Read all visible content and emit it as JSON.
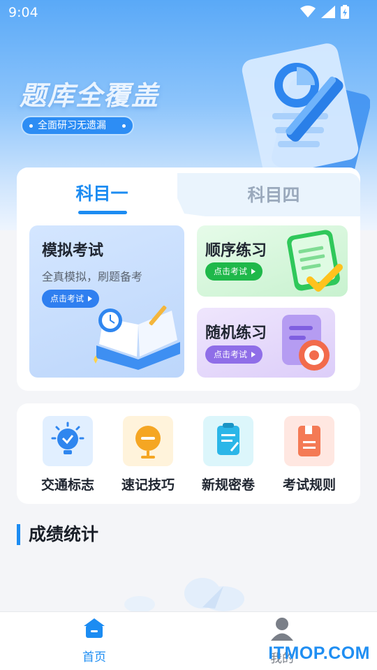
{
  "status_bar": {
    "time": "9:04"
  },
  "hero": {
    "title": "题库全覆盖",
    "pill": "全面研习无遗漏"
  },
  "subject_tabs": [
    {
      "label": "科目一",
      "active": true
    },
    {
      "label": "科目四",
      "active": false
    }
  ],
  "practice_tiles": [
    {
      "title": "模拟考试",
      "subtitle": "全真模拟，刷题备考",
      "button": "点击考试",
      "color": "#2f7ff0"
    },
    {
      "title": "顺序练习",
      "button": "点击考试",
      "color": "#1fb84a"
    },
    {
      "title": "随机练习",
      "button": "点击考试",
      "color": "#8f6ee8"
    }
  ],
  "tools": [
    {
      "label": "交通标志",
      "icon": "lightbulb-icon"
    },
    {
      "label": "速记技巧",
      "icon": "lamp-icon"
    },
    {
      "label": "新规密卷",
      "icon": "clipboard-icon"
    },
    {
      "label": "考试规则",
      "icon": "book-icon"
    }
  ],
  "section": {
    "title": "成绩统计"
  },
  "bottom_nav": [
    {
      "label": "首页",
      "icon": "home-icon",
      "active": true,
      "color": "#1c8cf2"
    },
    {
      "label": "我的",
      "icon": "user-icon",
      "active": false,
      "color": "#7a7f88"
    }
  ],
  "watermark": "ITMOP.COM"
}
